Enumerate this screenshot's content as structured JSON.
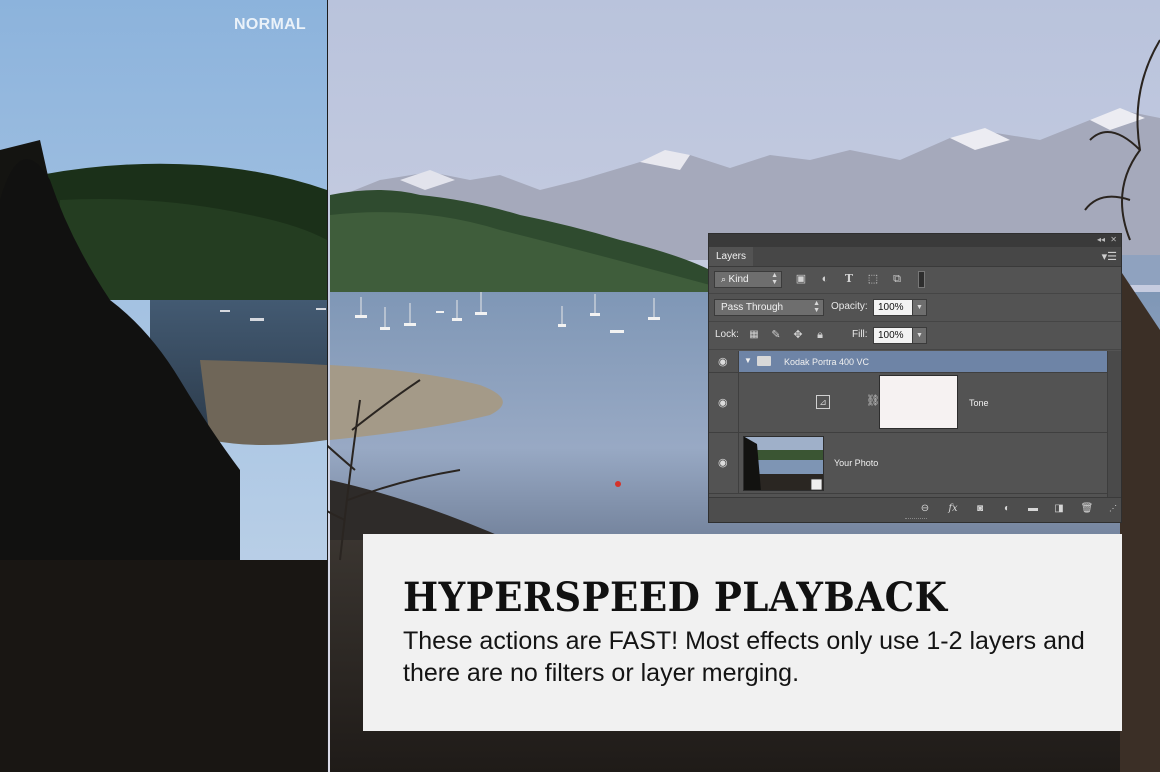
{
  "comparison": {
    "left_label": "NORMAL"
  },
  "layers_panel": {
    "tab_label": "Layers",
    "filter": {
      "kind_label": "Kind",
      "filter_icons": [
        "image-filter-icon",
        "adjustment-filter-icon",
        "type-filter-icon",
        "shape-filter-icon",
        "smart-object-filter-icon"
      ]
    },
    "blend_mode": "Pass Through",
    "opacity_label": "Opacity:",
    "opacity_value": "100%",
    "lock_label": "Lock:",
    "lock_icons": [
      "lock-transparent-pixels-icon",
      "lock-image-pixels-icon",
      "lock-position-icon",
      "lock-all-icon"
    ],
    "fill_label": "Fill:",
    "fill_value": "100%",
    "layers": [
      {
        "name": "Kodak Portra 400 VC",
        "kind": "group",
        "selected": true,
        "visible": true
      },
      {
        "name": "Tone",
        "kind": "adjustment",
        "visible": true
      },
      {
        "name": "Your Photo",
        "kind": "image",
        "visible": true
      }
    ],
    "bottom_icons": [
      "link-layers-icon",
      "fx-icon",
      "add-mask-icon",
      "new-adjustment-icon",
      "new-group-icon",
      "new-layer-icon",
      "trash-icon"
    ]
  },
  "caption": {
    "heading": "HYPERSPEED PLAYBACK",
    "body": "These actions are FAST! Most effects only use 1-2 layers and there are no filters or layer merging."
  },
  "colors": {
    "panel_bg": "#535353",
    "selected_layer": "#6e84a6",
    "caption_bg": "#f1f1f1"
  }
}
